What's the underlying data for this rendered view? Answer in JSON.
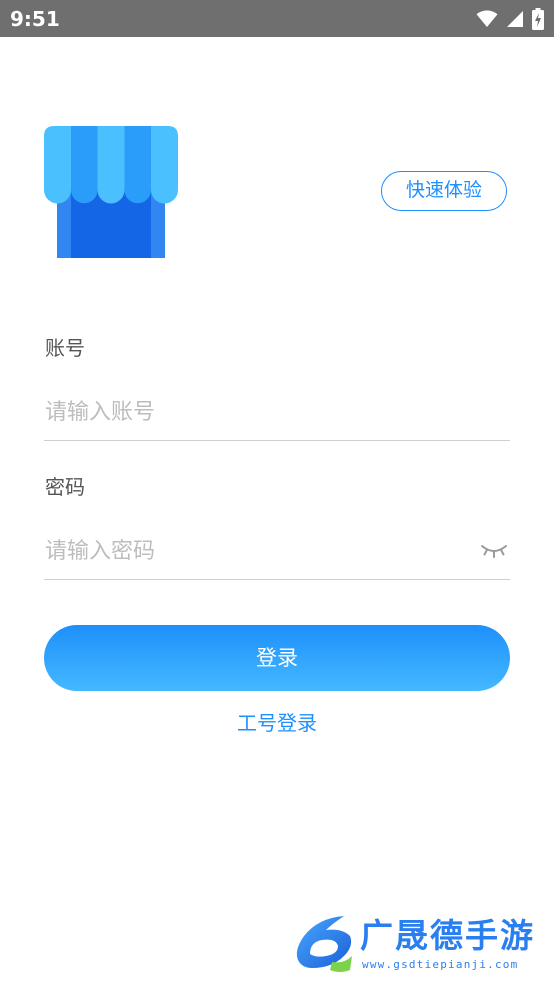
{
  "status_bar": {
    "time": "9:51",
    "icons": [
      "wifi-icon",
      "cellular-signal-icon",
      "battery-charging-icon"
    ],
    "background": "#6f6f6f"
  },
  "header": {
    "logo_icon": "shop-storefront-icon",
    "quick_experience_label": "快速体验"
  },
  "form": {
    "account": {
      "label": "账号",
      "placeholder": "请输入账号",
      "value": ""
    },
    "password": {
      "label": "密码",
      "placeholder": "请输入密码",
      "value": "",
      "toggle_icon": "eye-closed-icon"
    },
    "login_label": "登录",
    "staff_login_label": "工号登录"
  },
  "watermark": {
    "brand": "广晟德手游",
    "url": "www.gsdtiepianji.com"
  },
  "colors": {
    "accent": "#1e90ff",
    "button_gradient_top": "#1e8ffb",
    "button_gradient_bottom": "#44b9ff",
    "placeholder": "#bdbdbd",
    "label": "#555555"
  }
}
